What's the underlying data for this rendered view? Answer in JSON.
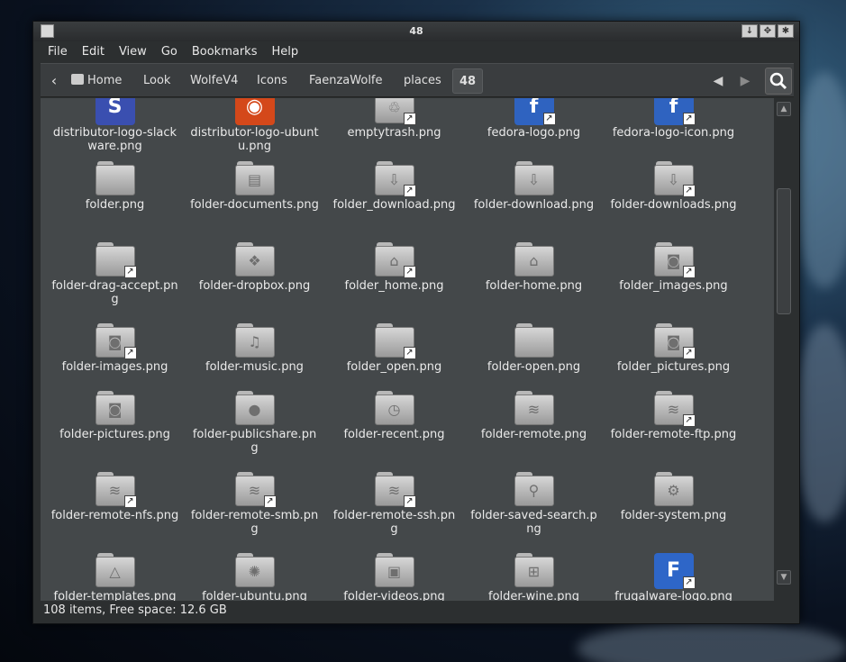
{
  "window": {
    "title": "48"
  },
  "menu": [
    "File",
    "Edit",
    "View",
    "Go",
    "Bookmarks",
    "Help"
  ],
  "pathbar": {
    "crumbs": [
      "Home",
      "Look",
      "WolfeV4",
      "Icons",
      "FaenzaWolfe",
      "places",
      "48"
    ]
  },
  "files": [
    {
      "name": "distributor-logo-slackware.png",
      "icon": "slackware-logo-icon"
    },
    {
      "name": "distributor-logo-ubuntu.png",
      "icon": "ubuntu-logo-icon"
    },
    {
      "name": "emptytrash.png",
      "icon": "trash-icon",
      "link": true
    },
    {
      "name": "fedora-logo.png",
      "icon": "fedora-logo-icon",
      "link": true
    },
    {
      "name": "fedora-logo-icon.png",
      "icon": "fedora-logo-icon",
      "link": true
    },
    {
      "name": "folder.png",
      "icon": "folder-icon"
    },
    {
      "name": "folder-documents.png",
      "icon": "folder-documents-icon"
    },
    {
      "name": "folder_download.png",
      "icon": "folder-download-icon",
      "link": true
    },
    {
      "name": "folder-download.png",
      "icon": "folder-download-icon"
    },
    {
      "name": "folder-downloads.png",
      "icon": "folder-download-icon",
      "link": true
    },
    {
      "name": "folder-drag-accept.png",
      "icon": "folder-icon",
      "link": true
    },
    {
      "name": "folder-dropbox.png",
      "icon": "folder-dropbox-icon"
    },
    {
      "name": "folder_home.png",
      "icon": "folder-home-icon",
      "link": true
    },
    {
      "name": "folder-home.png",
      "icon": "folder-home-icon"
    },
    {
      "name": "folder_images.png",
      "icon": "folder-camera-icon",
      "link": true
    },
    {
      "name": "folder-images.png",
      "icon": "folder-camera-icon",
      "link": true
    },
    {
      "name": "folder-music.png",
      "icon": "folder-music-icon"
    },
    {
      "name": "folder_open.png",
      "icon": "folder-icon",
      "link": true
    },
    {
      "name": "folder-open.png",
      "icon": "folder-icon"
    },
    {
      "name": "folder_pictures.png",
      "icon": "folder-camera-icon",
      "link": true
    },
    {
      "name": "folder-pictures.png",
      "icon": "folder-camera-icon"
    },
    {
      "name": "folder-publicshare.png",
      "icon": "folder-user-icon"
    },
    {
      "name": "folder-recent.png",
      "icon": "folder-clock-icon"
    },
    {
      "name": "folder-remote.png",
      "icon": "folder-wifi-icon"
    },
    {
      "name": "folder-remote-ftp.png",
      "icon": "folder-wifi-icon",
      "link": true
    },
    {
      "name": "folder-remote-nfs.png",
      "icon": "folder-wifi-icon",
      "link": true
    },
    {
      "name": "folder-remote-smb.png",
      "icon": "folder-wifi-icon",
      "link": true
    },
    {
      "name": "folder-remote-ssh.png",
      "icon": "folder-wifi-icon",
      "link": true
    },
    {
      "name": "folder-saved-search.png",
      "icon": "folder-search-icon"
    },
    {
      "name": "folder-system.png",
      "icon": "folder-gear-icon"
    },
    {
      "name": "folder-templates.png",
      "icon": "folder-compass-icon"
    },
    {
      "name": "folder-ubuntu.png",
      "icon": "folder-ubuntu-icon"
    },
    {
      "name": "folder-videos.png",
      "icon": "folder-film-icon"
    },
    {
      "name": "folder-wine.png",
      "icon": "folder-windows-icon"
    },
    {
      "name": "frugalware-logo.png",
      "icon": "frugalware-logo-icon",
      "link": true
    }
  ],
  "status": "108 items, Free space: 12.6 GB",
  "colors": {
    "content_bg": "#44484a",
    "window_bg": "#2c2f30",
    "slackware": "#3a4fb0",
    "ubuntu": "#d4481a",
    "fedora": "#2f63c0",
    "frugalware": "#2e66c8"
  }
}
